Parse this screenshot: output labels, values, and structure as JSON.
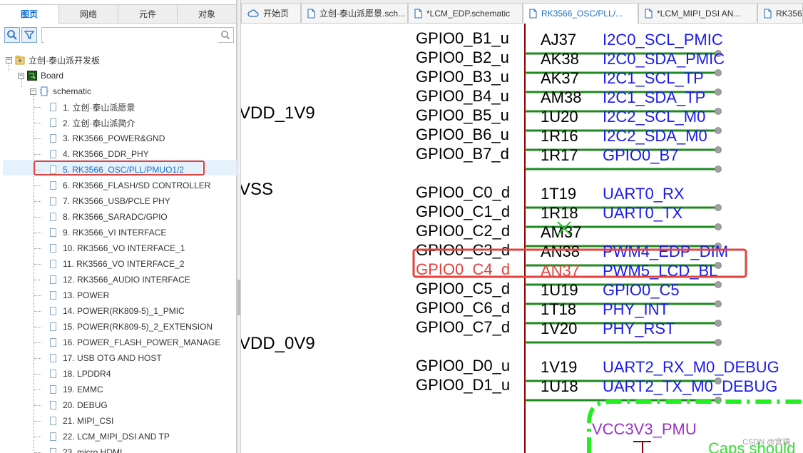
{
  "left_panel": {
    "tabs": [
      "图页",
      "网络",
      "元件",
      "对象"
    ],
    "search": {
      "placeholder": ""
    },
    "tree": {
      "root": "立创·泰山派开发板",
      "board": "Board",
      "schematic": "schematic",
      "pages": [
        "1. 立创·泰山派愿景",
        "2. 立创·泰山派简介",
        "3. RK3566_POWER&GND",
        "4. RK3566_DDR_PHY",
        "5. RK3566_OSC/PLL/PMUO1/2",
        "6. RK3566_FLASH/SD CONTROLLER",
        "7. RK3566_USB/PCLE PHY",
        "8. RK3566_SARADC/GPIO",
        "9. RK3566_VI INTERFACE",
        "10. RK3566_VO INTERFACE_1",
        "11. RK3566_VO INTERFACE_2",
        "12. RK3566_AUDIO INTERFACE",
        "13. POWER",
        "14. POWER(RK809-5)_1_PMIC",
        "15. POWER(RK809-5)_2_EXTENSION",
        "16. POWER_FLASH_POWER_MANAGE",
        "17. USB OTG AND HOST",
        "18. LPDDR4",
        "19. EMMC",
        "20. DEBUG",
        "21. MIPI_CSI",
        "22. LCM_MIPI_DSI AND TP",
        "23. micro HDMI"
      ],
      "selected_index": 4
    }
  },
  "doc_tabs": [
    {
      "label": "开始页",
      "icon": "cloud-icon",
      "active": false
    },
    {
      "label": "立创·泰山派愿景.sch...",
      "icon": "document-icon",
      "active": false
    },
    {
      "label": "*LCM_EDP.schematic",
      "icon": "document-icon",
      "active": false
    },
    {
      "label": "RK3566_OSC/PLL/...",
      "icon": "document-icon",
      "active": true
    },
    {
      "label": "*LCM_MIPI_DSI AN...",
      "icon": "document-icon",
      "active": false
    },
    {
      "label": "RK356",
      "icon": "document-icon",
      "active": false
    }
  ],
  "schematic": {
    "power_labels": [
      "VDD_1V9",
      "VSS",
      "VDD_0V9"
    ],
    "pins": [
      {
        "gpio": "GPIO0_B1_u",
        "ball": "AJ37",
        "net": "I2C0_SCL_PMIC"
      },
      {
        "gpio": "GPIO0_B2_u",
        "ball": "AK38",
        "net": "I2C0_SDA_PMIC"
      },
      {
        "gpio": "GPIO0_B3_u",
        "ball": "AK37",
        "net": "I2C1_SCL_TP"
      },
      {
        "gpio": "GPIO0_B4_u",
        "ball": "AM38",
        "net": "I2C1_SDA_TP"
      },
      {
        "gpio": "GPIO0_B5_u",
        "ball": "1U20",
        "net": "I2C2_SCL_M0"
      },
      {
        "gpio": "GPIO0_B6_u",
        "ball": "1R16",
        "net": "I2C2_SDA_M0"
      },
      {
        "gpio": "GPIO0_B7_d",
        "ball": "1R17",
        "net": "GPIO0_B7"
      },
      {
        "gpio": "GPIO0_C0_d",
        "ball": "1T19",
        "net": "UART0_RX"
      },
      {
        "gpio": "GPIO0_C1_d",
        "ball": "1R18",
        "net": "UART0_TX"
      },
      {
        "gpio": "GPIO0_C2_d",
        "ball": "AM37",
        "net": ""
      },
      {
        "gpio": "GPIO0_C3_d",
        "ball": "AN38",
        "net": "PWM4_EDP_DIM"
      },
      {
        "gpio": "GPIO0_C4_d",
        "ball": "AN37",
        "net": "PWM5_LCD_BL"
      },
      {
        "gpio": "GPIO0_C5_d",
        "ball": "1U19",
        "net": "GPIO0_C5"
      },
      {
        "gpio": "GPIO0_C6_d",
        "ball": "1T18",
        "net": "PHY_INT"
      },
      {
        "gpio": "GPIO0_C7_d",
        "ball": "1V20",
        "net": "PHY_RST"
      },
      {
        "gpio": "GPIO0_D0_u",
        "ball": "1V19",
        "net": "UART2_RX_M0_DEBUG"
      },
      {
        "gpio": "GPIO0_D1_u",
        "ball": "1U18",
        "net": "UART2_TX_M0_DEBUG"
      }
    ],
    "highlighted_pin_index": 11,
    "vcc_label": "VCC3V3_PMU",
    "note_text": "Caps should",
    "watermark": "CSDN @宫瑞",
    "colors": {
      "pin_text": "#000000",
      "net_text": "#1a1aee",
      "wire": "#1f8a1f",
      "body_line": "#8b0000",
      "highlight": "#e2433e",
      "vcc": "#9b30c8",
      "dashed_box": "#22ee22"
    }
  }
}
